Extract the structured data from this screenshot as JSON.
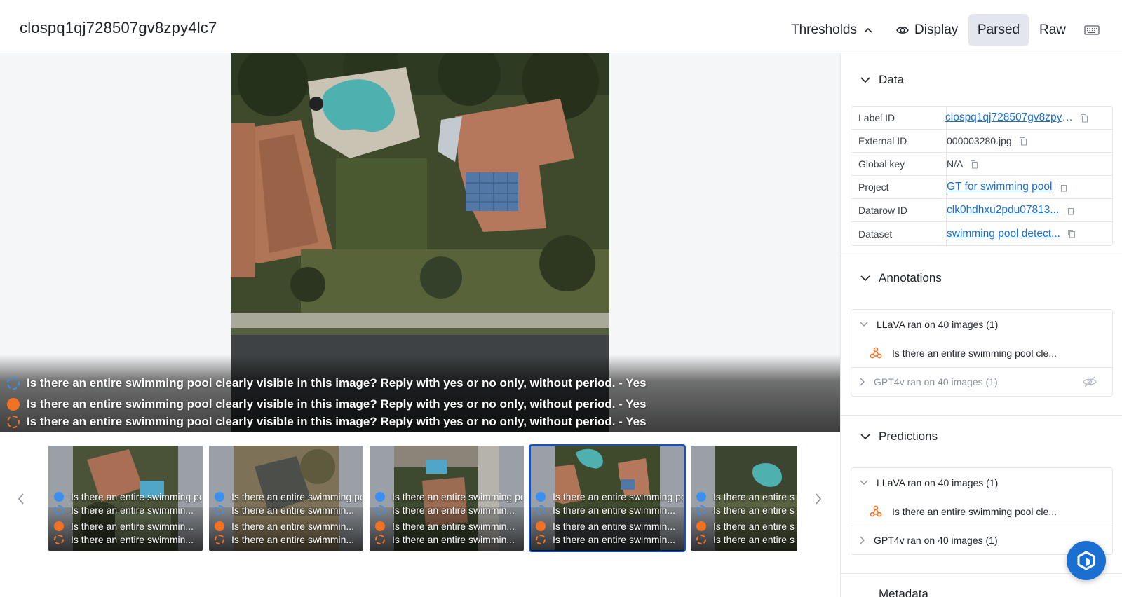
{
  "header": {
    "title": "clospq1qj728507gv8zpy4lc7",
    "thresholds_label": "Thresholds",
    "display_label": "Display",
    "parsed_label": "Parsed",
    "raw_label": "Raw"
  },
  "viewer": {
    "captions": [
      {
        "marker": "blue-dashed-circle",
        "text": "Is there an entire swimming pool clearly visible in this image? Reply with yes or no only, without period. - Yes"
      },
      {
        "marker": "orange-filled-circle",
        "text": "Is there an entire swimming pool clearly visible in this image? Reply with yes or no only, without period. - Yes"
      },
      {
        "marker": "orange-dashed-circle",
        "text": "Is there an entire swimming pool clearly visible in this image? Reply with yes or no only, without period. - Yes"
      }
    ]
  },
  "filmstrip": {
    "thumbs": [
      {
        "caps": [
          "Is there an entire swimming pool",
          "Is there an entire swimmin...",
          "Is there an entire swimmin...",
          "Is there an entire swimmin..."
        ]
      },
      {
        "caps": [
          "Is there an entire swimming pool",
          "Is there an entire swimmin...",
          "Is there an entire swimmin...",
          "Is there an entire swimmin..."
        ]
      },
      {
        "caps": [
          "Is there an entire swimming pool",
          "Is there an entire swimmin...",
          "Is there an entire swimmin...",
          "Is there an entire swimmin..."
        ]
      },
      {
        "caps": [
          "Is there an entire swimming pool",
          "Is there an entire swimmin...",
          "Is there an entire swimmin...",
          "Is there an entire swimmin..."
        ],
        "selected": true
      },
      {
        "caps": [
          "Is there an entire swimming pool",
          "Is there an entire swimmin...",
          "Is there an entire swimmin...",
          "Is there an entire swimmin..."
        ]
      }
    ]
  },
  "panel": {
    "data_title": "Data",
    "data_rows": [
      {
        "key": "Label ID",
        "value": "clospq1qj728507gv8zpy4lc7",
        "link": true
      },
      {
        "key": "External ID",
        "value": "000003280.jpg",
        "link": false
      },
      {
        "key": "Global key",
        "value": "N/A",
        "link": false
      },
      {
        "key": "Project",
        "value": "GT for swimming pool",
        "link": true
      },
      {
        "key": "Datarow ID",
        "value": "clk0hdhxu2pdu07813...",
        "link": true
      },
      {
        "key": "Dataset",
        "value": "swimming pool detect...",
        "link": true
      }
    ],
    "annotations_title": "Annotations",
    "annotations": {
      "group1": "LLaVA ran on 40 images (1)",
      "group1_item": "Is there an entire swimming pool cle...",
      "group2": "GPT4v ran on 40 images (1)"
    },
    "predictions_title": "Predictions",
    "predictions": {
      "group1": "LLaVA ran on 40 images (1)",
      "group1_item": "Is there an entire swimming pool cle...",
      "group2": "GPT4v ran on 40 images (1)"
    },
    "metadata_title": "Metadata"
  },
  "colors": {
    "accent": "#1a6fd1",
    "selected_border": "#1b4fb3",
    "prediction_orange": "#f27224",
    "annotation_blue": "#3a8ff0"
  }
}
